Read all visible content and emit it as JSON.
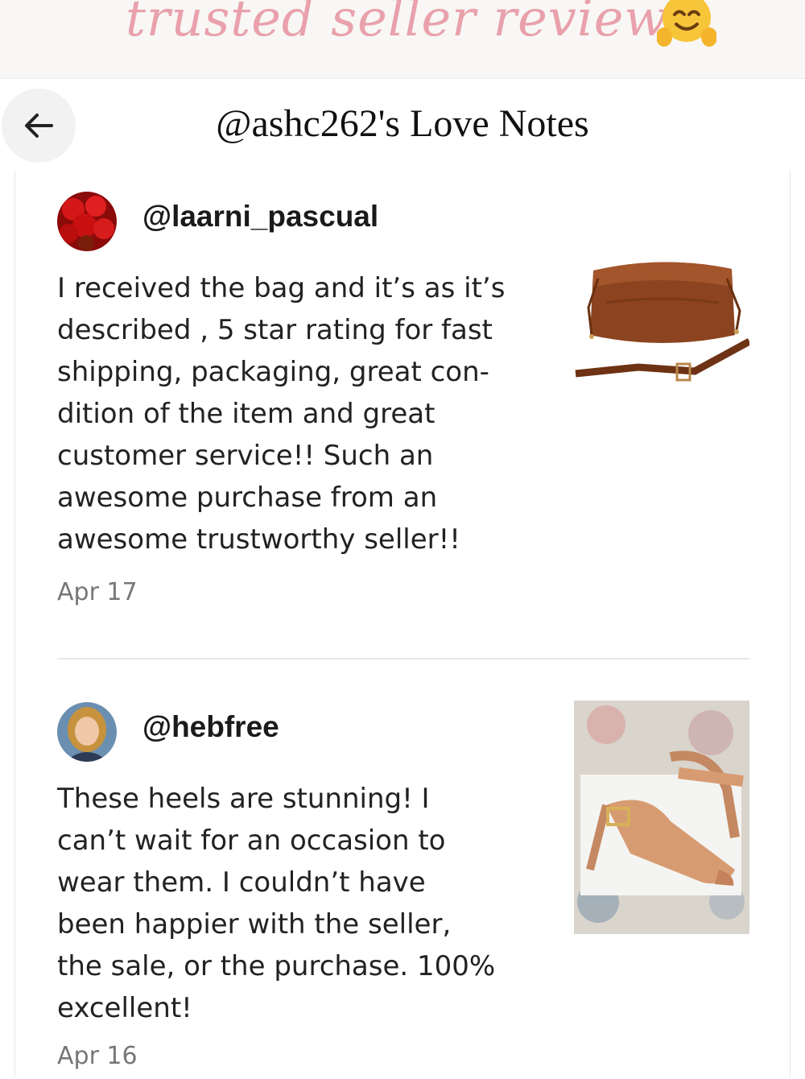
{
  "banner": {
    "text": "trusted seller reviews",
    "emoji_icon": "hugging-face-emoji"
  },
  "header": {
    "back_icon": "arrow-left-icon",
    "title": "@ashc262's Love Notes"
  },
  "reviews": [
    {
      "username": "@laarni_pascual",
      "avatar_icon": "red-roses-avatar",
      "text": "I received the bag and it’s as it’s\ndescribed , 5 star rating for fast\nshipping, packaging, great con-\ndition of the item and great\ncustomer service!! Such an\nawesome purchase from an\nawesome trustworthy seller!!",
      "date": "Apr 17",
      "item_image": "brown-leather-drawstring-bag"
    },
    {
      "username": "@hebfree",
      "avatar_icon": "woman-portrait-avatar",
      "text": "These heels are stunning! I\ncan’t wait for an occasion to\nwear them. I couldn’t have\nbeen happier with the seller,\nthe sale, or the purchase. 100%\nexcellent!",
      "date": "Apr 16",
      "item_image": "tan-slingback-heels"
    }
  ],
  "colors": {
    "banner_bg": "#f8f7f6",
    "banner_text": "#e9a1ab",
    "date": "#777777",
    "divider": "#e8e8e8"
  }
}
